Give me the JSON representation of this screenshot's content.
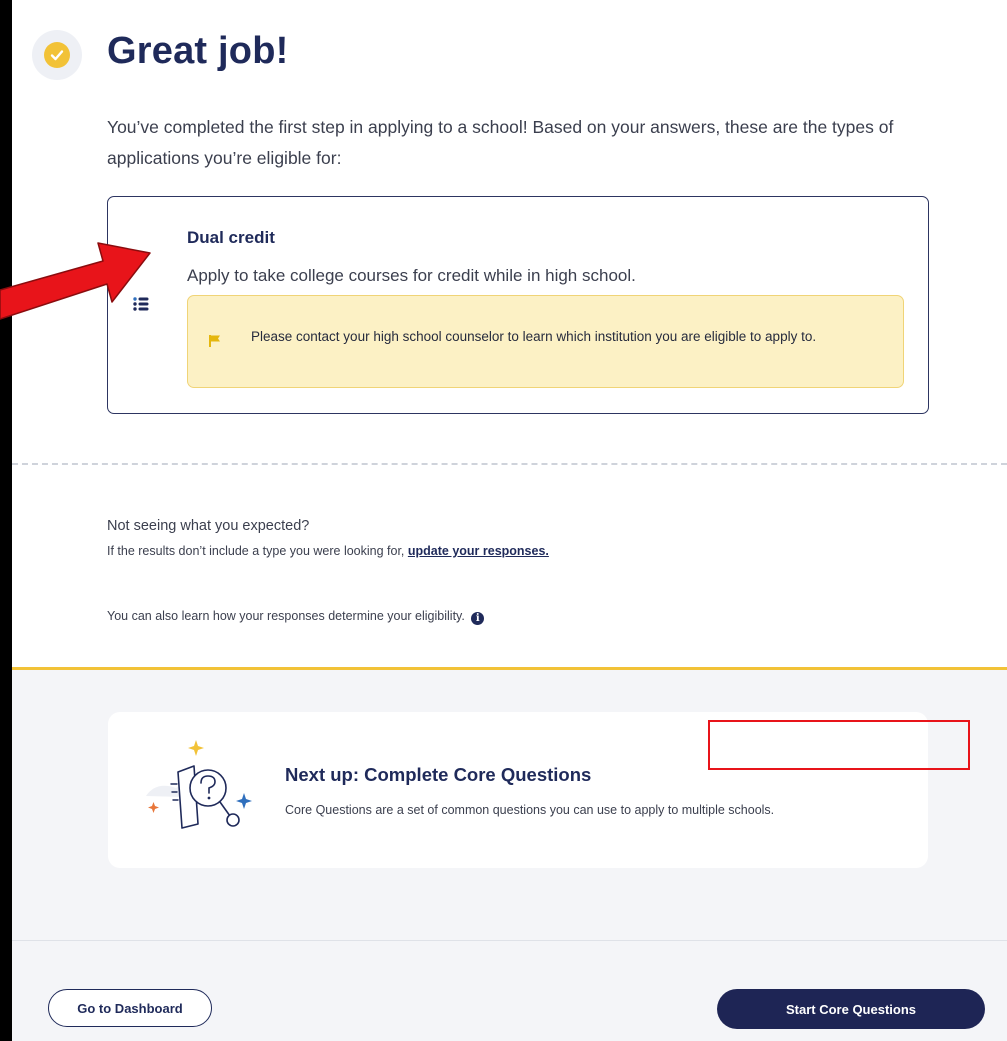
{
  "header": {
    "title": "Great job!",
    "intro": "You’ve completed the first step in applying to a school! Based on your answers, these are the types of applications you’re eligible for:"
  },
  "result_card": {
    "title": "Dual credit",
    "description": "Apply to take college courses for credit while in high school.",
    "notice": "Please contact your high school counselor to learn which institution you are eligible to apply to."
  },
  "expectations": {
    "question": "Not seeing what you expected?",
    "text_before_link": "If the results don’t include a type you were looking for, ",
    "link_label": "update your responses.",
    "learn_text": "You can also learn how your responses determine your eligibility."
  },
  "next_up": {
    "title": "Next up: Complete Core Questions",
    "description": "Core Questions are a set of common questions you can use to apply to multiple schools."
  },
  "footer": {
    "dashboard_button": "Go to Dashboard",
    "start_button": "Start Core Questions"
  },
  "colors": {
    "navy": "#1f2a5a",
    "gold": "#f2c237",
    "notice_bg": "#fcf1c5",
    "annotation_red": "#e8141a"
  },
  "icons": [
    "check-circle-icon",
    "list-icon",
    "flag-icon",
    "info-icon",
    "question-document-icon"
  ]
}
